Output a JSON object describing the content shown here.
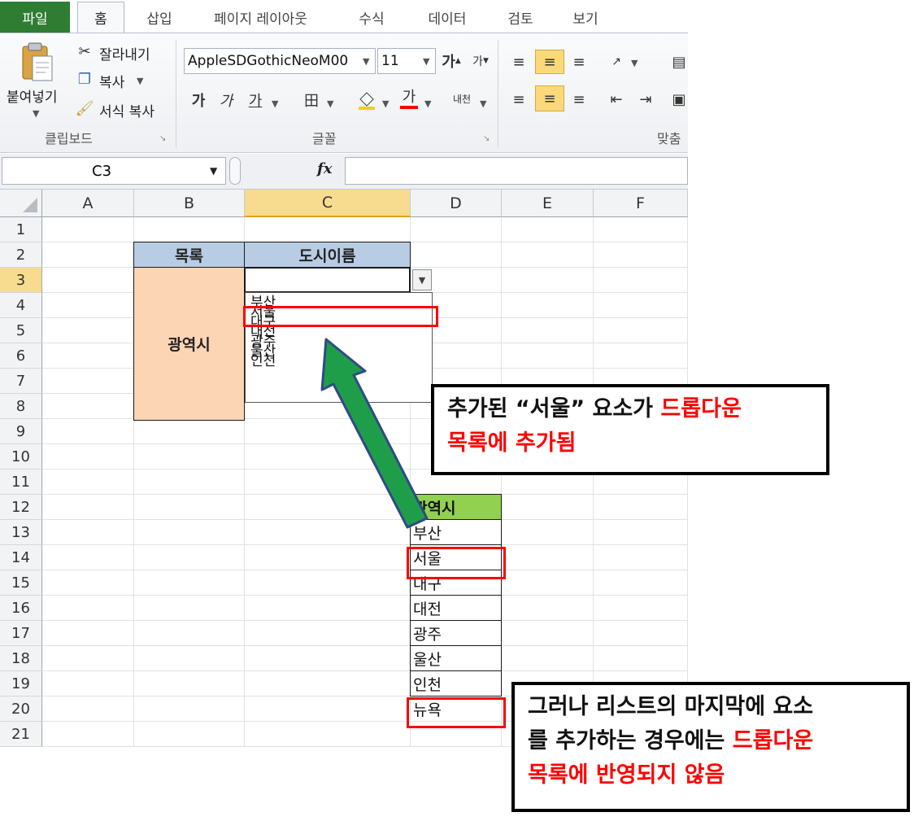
{
  "ribbon": {
    "tabs": [
      "파일",
      "홈",
      "삽입",
      "페이지 레이아웃",
      "수식",
      "데이터",
      "검토",
      "보기"
    ],
    "clipboard": {
      "paste": "붙여넣기",
      "cut": "잘라내기",
      "copy": "복사",
      "format_painter": "서식 복사",
      "group_label": "클립보드"
    },
    "font": {
      "font_name": "AppleSDGothicNeoM00",
      "font_size": "11",
      "group_label": "글꼴",
      "bold": "가",
      "italic": "가",
      "underline": "가",
      "font_color_glyph": "가",
      "phonetic": "내천"
    },
    "alignment": {
      "group_label": "맞춤"
    }
  },
  "formula_bar": {
    "name_box": "C3",
    "fx": "fx",
    "formula": ""
  },
  "grid": {
    "columns": [
      "A",
      "B",
      "C",
      "D",
      "E",
      "F"
    ],
    "rows": [
      "1",
      "2",
      "3",
      "4",
      "5",
      "6",
      "7",
      "8",
      "9",
      "10",
      "11",
      "12",
      "13",
      "14",
      "15",
      "16",
      "17",
      "18",
      "19",
      "20",
      "21"
    ],
    "header_list": "목록",
    "header_city": "도시이름",
    "merged_label": "광역시",
    "dropdown_items": [
      "부산",
      "서울",
      "대구",
      "대전",
      "광주",
      "울산",
      "인천"
    ],
    "source_header": "광역시",
    "source_items": [
      "부산",
      "서울",
      "대구",
      "대전",
      "광주",
      "울산",
      "인천",
      "뉴욕"
    ]
  },
  "annotations": {
    "callout1_line1": "추가된 “서울” 요소가 ",
    "callout1_red1": "드롭다운",
    "callout1_red2": "목록에 추가됨",
    "callout2_line1": "그러나 리스트의 마지막에 요소",
    "callout2_line2a": "를 추가하는 경우에는 ",
    "callout2_red1": "드롭다운",
    "callout2_red2": "목록에 반영되지 않음"
  },
  "colors": {
    "accent_red": "#ff0000",
    "arrow_green": "#1f9e4a",
    "header_blue": "#b8cce4",
    "merged_peach": "#fcd5b4",
    "source_green": "#92d050"
  }
}
